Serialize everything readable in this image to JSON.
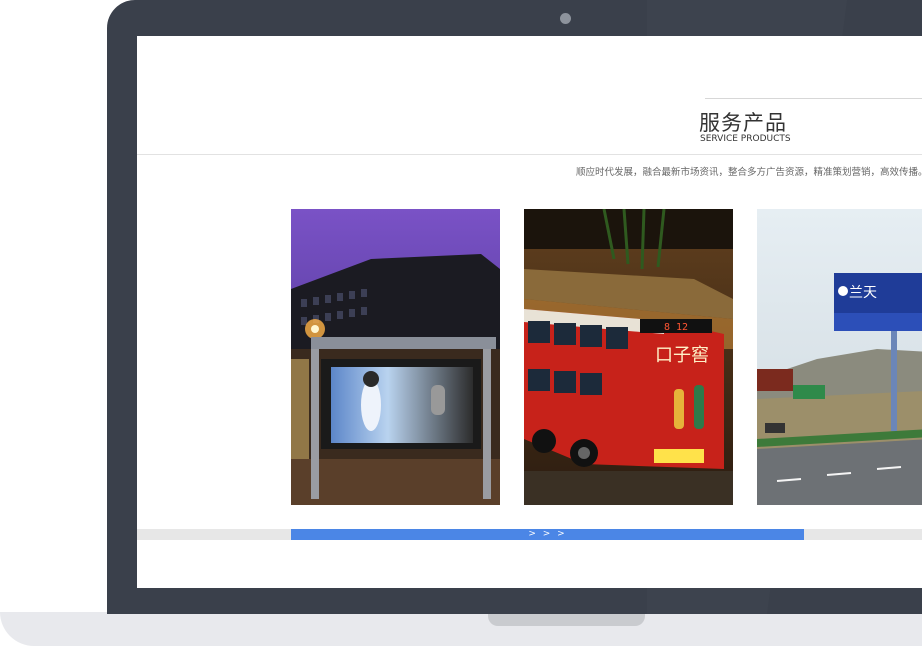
{
  "section": {
    "title_zh": "服务产品",
    "title_en": "SERVICE PRODUCTS",
    "slogan": "顺应时代发展，融合最新市场资讯，整合多方广告资源，精准策划营销，高效传播。"
  },
  "cards": [
    {
      "name": "bus-shelter-billboard",
      "icon": "bus-shelter-photo"
    },
    {
      "name": "bus-body-advertising",
      "icon": "bus-photo"
    },
    {
      "name": "highway-billboard",
      "icon": "highway-billboard-photo"
    }
  ],
  "bus_ad": {
    "route_display": "8 12",
    "brand_text": "口子窖"
  },
  "billboard": {
    "brand_text": "兰天"
  },
  "scrollbar": {
    "arrows": "> > >"
  },
  "colors": {
    "bezel": "#3a404b",
    "accent": "#4b86e6",
    "track": "#e7e7e7"
  }
}
